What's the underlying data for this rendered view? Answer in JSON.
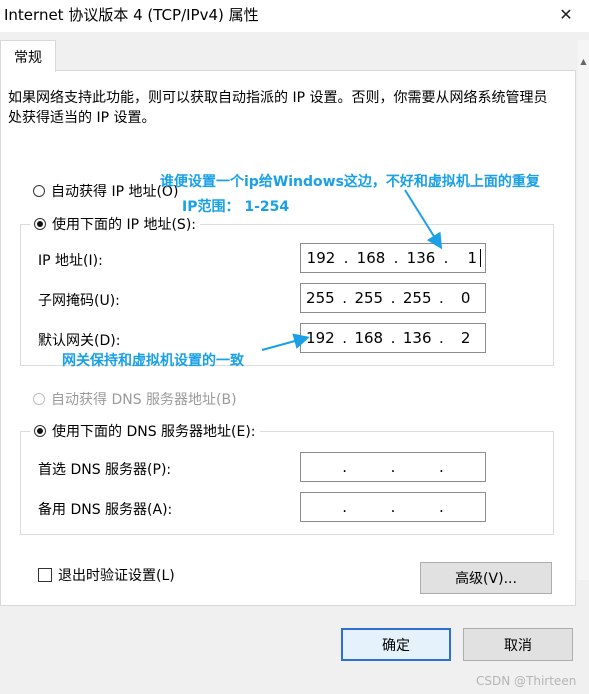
{
  "window": {
    "title": "Internet 协议版本 4 (TCP/IPv4) 属性",
    "close_glyph": "✕"
  },
  "tabs": [
    {
      "label": "常规"
    }
  ],
  "description": "如果网络支持此功能，则可以获取自动指派的 IP 设置。否则，你需要从网络系统管理员处获得适当的 IP 设置。",
  "ip_section": {
    "auto_option": {
      "label": "自动获得 IP 地址(O)",
      "selected": false
    },
    "manual_option": {
      "label": "使用下面的 IP 地址(S):",
      "selected": true
    },
    "fields": [
      {
        "label": "IP 地址(I):",
        "octets": [
          "192",
          "168",
          "136",
          "1"
        ]
      },
      {
        "label": "子网掩码(U):",
        "octets": [
          "255",
          "255",
          "255",
          "0"
        ]
      },
      {
        "label": "默认网关(D):",
        "octets": [
          "192",
          "168",
          "136",
          "2"
        ]
      }
    ]
  },
  "dns_section": {
    "auto_option": {
      "label": "自动获得 DNS 服务器地址(B)",
      "selected": false,
      "enabled": false
    },
    "manual_option": {
      "label": "使用下面的 DNS 服务器地址(E):",
      "selected": true
    },
    "fields": [
      {
        "label": "首选 DNS 服务器(P):",
        "octets": [
          "",
          "",
          "",
          ""
        ]
      },
      {
        "label": "备用 DNS 服务器(A):",
        "octets": [
          "",
          "",
          "",
          ""
        ]
      }
    ]
  },
  "validate_checkbox": {
    "label": "退出时验证设置(L)",
    "checked": false
  },
  "buttons": {
    "advanced": "高级(V)...",
    "ok": "确定",
    "cancel": "取消"
  },
  "annotations": {
    "note1": "谁便设置一个ip给Windows这边，不好和虚拟机上面的重复",
    "note2": "IP范围： 1-254",
    "note3": "网关保持和虚拟机设置的一致"
  },
  "watermark": "CSDN @Thirteen",
  "colors": {
    "annotation": "#1aa0e6",
    "default_button_border": "#2f6fd1"
  }
}
